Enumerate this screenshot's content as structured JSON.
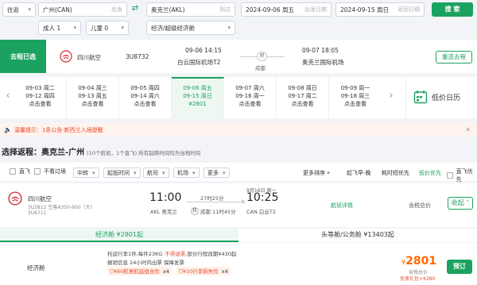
{
  "search": {
    "trip_type": "往返",
    "from_city": "广州(CAN)",
    "from_placeholder": "出发",
    "to_city": "奥克兰(AKL)",
    "to_placeholder": "到达",
    "depart_date": "2024-09-06 周五",
    "depart_placeholder": "出发日期",
    "return_date": "2024-09-15 周日",
    "return_placeholder": "返回日期",
    "search_label": "搜 索",
    "adult": "成人 1",
    "child": "儿童 0",
    "cabin": "经济/超级经济舱"
  },
  "selected_outbound": {
    "badge": "去程已选",
    "airline": "四川航空",
    "flight_no": "3U8732",
    "dep_time": "09-06 14:15",
    "dep_airport": "白云国际机场T2",
    "transfer_label": "转",
    "transfer_city": "成都",
    "arr_time": "09-07 18:05",
    "arr_airport": "奥克兰国际机场",
    "reselect_label": "重选去程"
  },
  "date_tabs": [
    {
      "depart": "09-03 周二",
      "return": "09-12 周四",
      "price": "点击查看"
    },
    {
      "depart": "09-04 周三",
      "return": "09-13 周五",
      "price": "点击查看"
    },
    {
      "depart": "09-05 周四",
      "return": "09-14 周六",
      "price": "点击查看"
    },
    {
      "depart": "09-06 周五",
      "return": "09-15 周日",
      "price": "¥2801"
    },
    {
      "depart": "09-07 周六",
      "return": "09-16 周一",
      "price": "点击查看"
    },
    {
      "depart": "09-08 周日",
      "return": "09-17 周二",
      "price": "点击查看"
    },
    {
      "depart": "09-09 周一",
      "return": "09-18 周三",
      "price": "点击查看"
    }
  ],
  "low_price_calendar": "低价日历",
  "notice": {
    "label": "温馨提示：",
    "count": "1条公告",
    "text": "·新西兰入境提醒"
  },
  "return_header": {
    "title_prefix": "选择返程：",
    "route": "奥克兰-广州",
    "summary": "(10个航班，1个直飞) 所有起降时间均为当地时间"
  },
  "filters": {
    "direct": "直飞",
    "hide_shared": "不看过境",
    "transit": "中转",
    "dep_time": "起抵时间",
    "airline": "航司",
    "airport": "机场",
    "more": "更多",
    "more_sort": "更多排序",
    "sort_departure": "起飞早-晚",
    "sort_duration": "耗时短优先",
    "sort_price": "低价优先",
    "direct_first": "直飞优先"
  },
  "flight": {
    "airline": "四川航空",
    "flight_no": "3U3812 空客A350-900（大）",
    "flight_no_2": "3U6711",
    "dep_date_note": "9月16日 周一",
    "dep_time": "11:00",
    "dep_airport": "AKL 奥克兰",
    "duration": "27时25分",
    "stop_label": "转",
    "stop_city": "成都",
    "stop_duration": "11时45分",
    "arr_time": "10:25",
    "arr_airport": "CAN 白云T2",
    "details_link": "航班详情",
    "total_label": "含税总价",
    "collapse_label": "收起"
  },
  "cabin_tabs": {
    "economy": "经济舱 ¥2801起",
    "business": "头等舱/公务舱 ¥13403起"
  },
  "fare": {
    "cabin_name": "经济舱",
    "baggage": "托运行李1件,每件23KG",
    "refund_tag": "不得退票",
    "change_fee": ",部分行程改期¥430起",
    "ticket_info": "报销信息   24小时内出票   保障发票",
    "coupon_1": "¥60航意航延组合险",
    "coupon_1_count": "x4",
    "coupon_2": "¥10行李损失险",
    "coupon_2_count": "x4",
    "price": "2801",
    "price_currency": "¥",
    "price_note": "含税总价",
    "gift_note": "优享礼包+¥280",
    "book_label": "预订"
  },
  "colors": {
    "accent": "#1ba260",
    "price": "#ff6a00",
    "red": "#d9272e"
  }
}
